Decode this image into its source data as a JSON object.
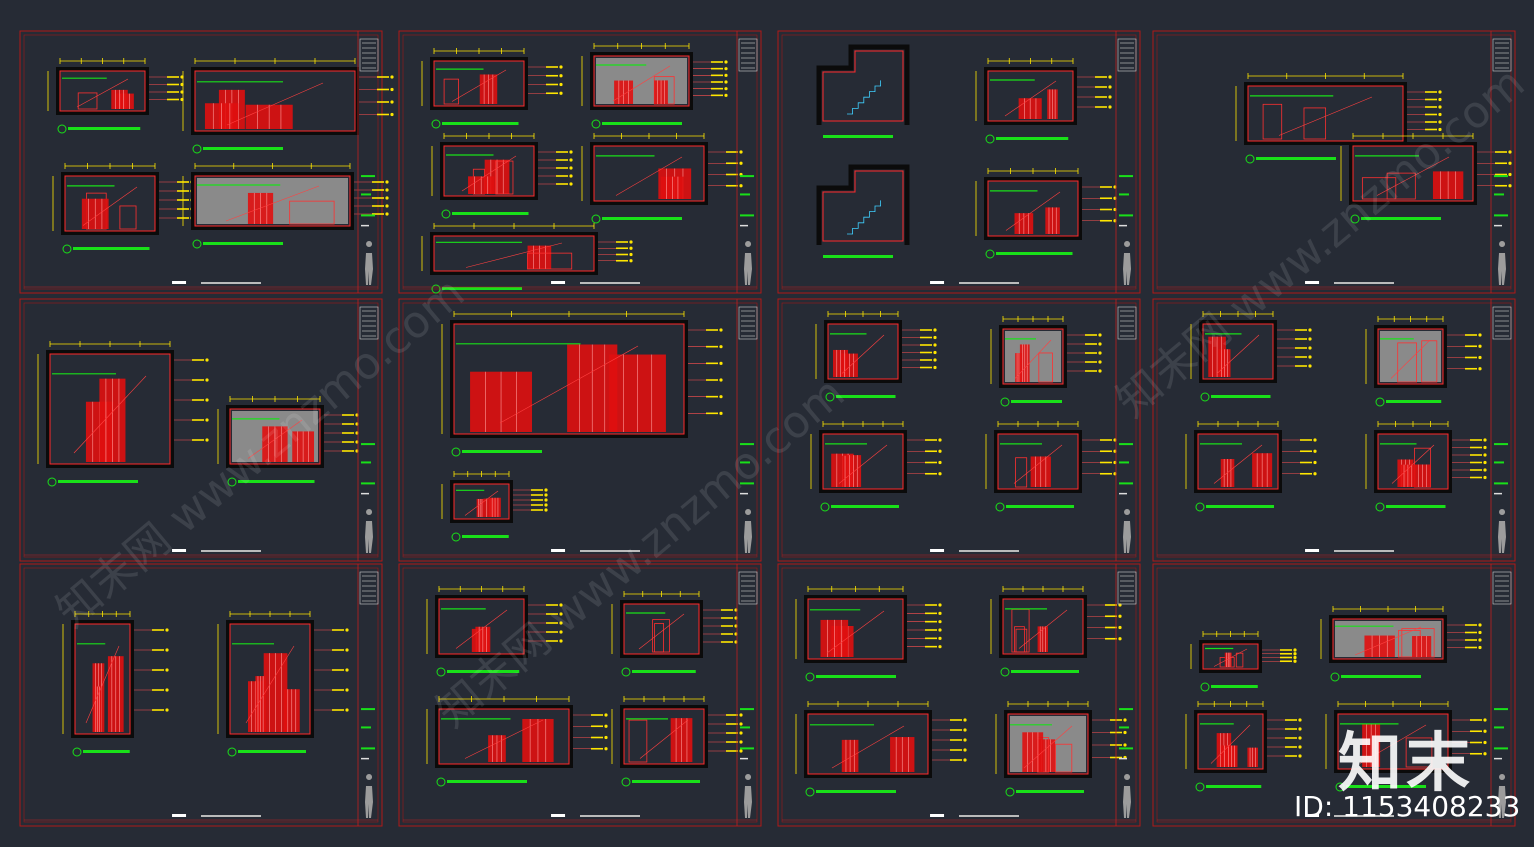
{
  "watermark": {
    "logo_text": "知末",
    "id_text": "ID: 1153408233",
    "diagonal_text": "知末网 www.znzmo.com"
  },
  "colors": {
    "background": "#262b35",
    "sheet_border": "#b01818",
    "wall_poche": "#0b0b0b",
    "elevation_red": "#e01010",
    "dimension_yellow": "#ffe600",
    "title_green": "#19e019",
    "material_gray": "#8a8a8a"
  },
  "sheets": [
    {
      "id": "sheet-r1c1"
    },
    {
      "id": "sheet-r1c2"
    },
    {
      "id": "sheet-r1c3"
    },
    {
      "id": "sheet-r1c4"
    },
    {
      "id": "sheet-r2c1"
    },
    {
      "id": "sheet-r2c2"
    },
    {
      "id": "sheet-r2c3"
    },
    {
      "id": "sheet-r2c4"
    },
    {
      "id": "sheet-r3c1"
    },
    {
      "id": "sheet-r3c2"
    },
    {
      "id": "sheet-r3c3"
    },
    {
      "id": "sheet-r3c4"
    }
  ]
}
